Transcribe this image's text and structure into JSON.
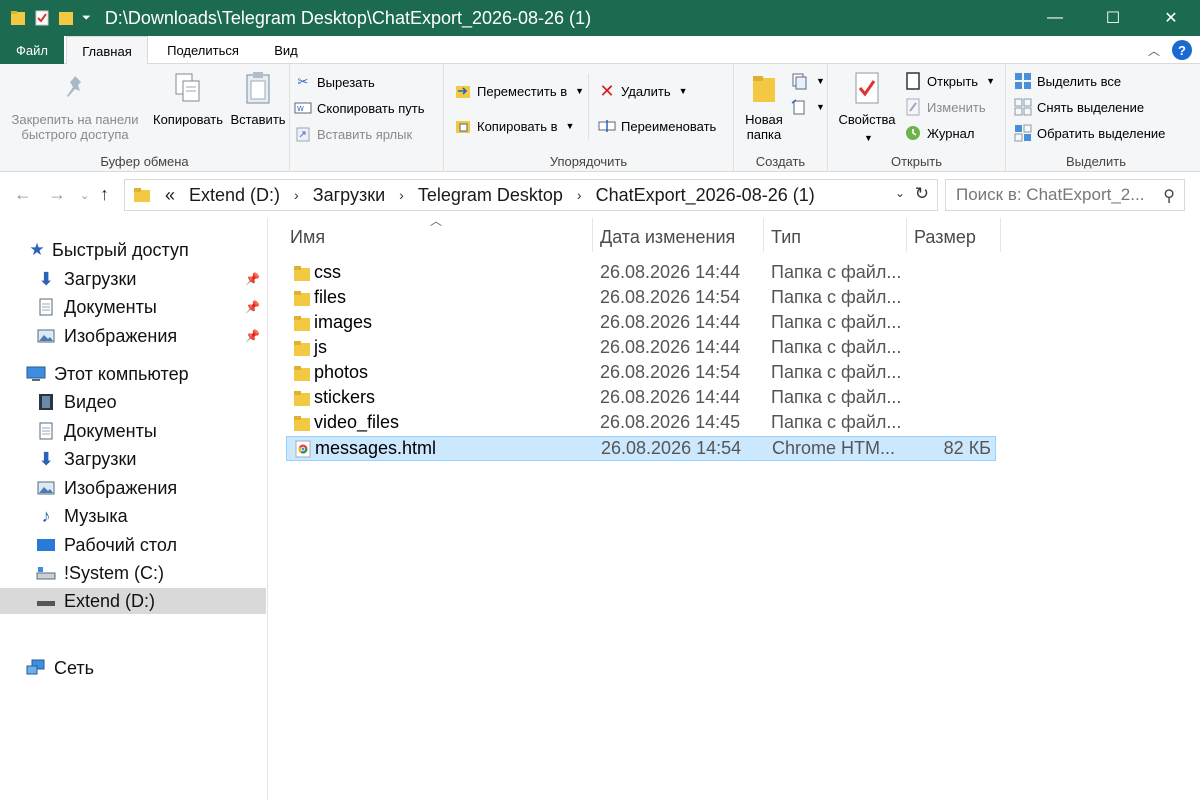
{
  "window": {
    "title": "D:\\Downloads\\Telegram Desktop\\ChatExport_2026-08-26 (1)",
    "accent_color": "#1c6b50"
  },
  "tabs": {
    "file": "Файл",
    "home": "Главная",
    "share": "Поделиться",
    "view": "Вид"
  },
  "ribbon": {
    "clipboard": {
      "label": "Буфер обмена",
      "pin": "Закрепить на панели быстрого доступа",
      "copy": "Копировать",
      "paste": "Вставить",
      "cut": "Вырезать",
      "copy_path": "Скопировать путь",
      "paste_shortcut": "Вставить ярлык"
    },
    "organize": {
      "label": "Упорядочить",
      "move_to": "Переместить в",
      "copy_to": "Копировать в",
      "delete": "Удалить",
      "rename": "Переименовать"
    },
    "new": {
      "label": "Создать",
      "new_folder": "Новая папка"
    },
    "open": {
      "label": "Открыть",
      "properties": "Свойства",
      "open": "Открыть",
      "edit": "Изменить",
      "history": "Журнал"
    },
    "select": {
      "label": "Выделить",
      "select_all": "Выделить все",
      "select_none": "Снять выделение",
      "invert": "Обратить выделение"
    }
  },
  "address": {
    "overflow": "«",
    "segments": [
      "Extend (D:)",
      "Загрузки",
      "Telegram Desktop",
      "ChatExport_2026-08-26 (1)"
    ],
    "search_placeholder": "Поиск в: ChatExport_2..."
  },
  "nav": {
    "quick_access": "Быстрый доступ",
    "quick_items": [
      "Загрузки",
      "Документы",
      "Изображения"
    ],
    "this_pc": "Этот компьютер",
    "pc_items": [
      "Видео",
      "Документы",
      "Загрузки",
      "Изображения",
      "Музыка",
      "Рабочий стол",
      "!System (C:)",
      "Extend (D:)"
    ],
    "network": "Сеть"
  },
  "columns": {
    "name": "Имя",
    "date": "Дата изменения",
    "type": "Тип",
    "size": "Размер"
  },
  "files": [
    {
      "name": "css",
      "date": "26.08.2026 14:44",
      "type": "Папка с файл...",
      "size": ""
    },
    {
      "name": "files",
      "date": "26.08.2026 14:54",
      "type": "Папка с файл...",
      "size": ""
    },
    {
      "name": "images",
      "date": "26.08.2026 14:44",
      "type": "Папка с файл...",
      "size": ""
    },
    {
      "name": "js",
      "date": "26.08.2026 14:44",
      "type": "Папка с файл...",
      "size": ""
    },
    {
      "name": "photos",
      "date": "26.08.2026 14:54",
      "type": "Папка с файл...",
      "size": ""
    },
    {
      "name": "stickers",
      "date": "26.08.2026 14:44",
      "type": "Папка с файл...",
      "size": ""
    },
    {
      "name": "video_files",
      "date": "26.08.2026 14:45",
      "type": "Папка с файл...",
      "size": ""
    },
    {
      "name": "messages.html",
      "date": "26.08.2026 14:54",
      "type": "Chrome HTM...",
      "size": "82 КБ"
    }
  ]
}
